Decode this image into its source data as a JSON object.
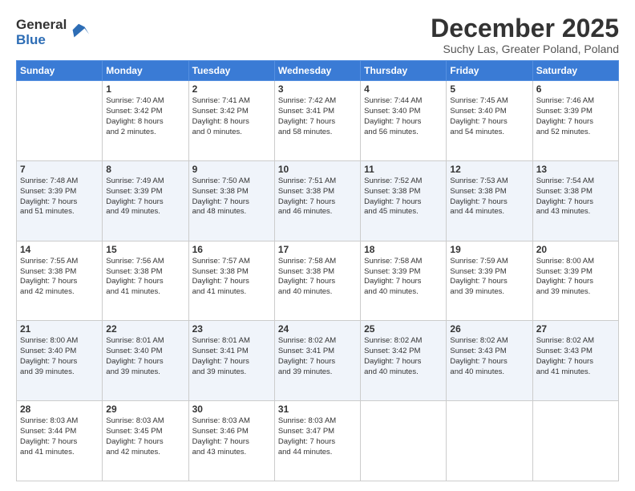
{
  "logo": {
    "general": "General",
    "blue": "Blue"
  },
  "title": "December 2025",
  "subtitle": "Suchy Las, Greater Poland, Poland",
  "days_of_week": [
    "Sunday",
    "Monday",
    "Tuesday",
    "Wednesday",
    "Thursday",
    "Friday",
    "Saturday"
  ],
  "weeks": [
    [
      {
        "day": "",
        "info": ""
      },
      {
        "day": "1",
        "info": "Sunrise: 7:40 AM\nSunset: 3:42 PM\nDaylight: 8 hours\nand 2 minutes."
      },
      {
        "day": "2",
        "info": "Sunrise: 7:41 AM\nSunset: 3:42 PM\nDaylight: 8 hours\nand 0 minutes."
      },
      {
        "day": "3",
        "info": "Sunrise: 7:42 AM\nSunset: 3:41 PM\nDaylight: 7 hours\nand 58 minutes."
      },
      {
        "day": "4",
        "info": "Sunrise: 7:44 AM\nSunset: 3:40 PM\nDaylight: 7 hours\nand 56 minutes."
      },
      {
        "day": "5",
        "info": "Sunrise: 7:45 AM\nSunset: 3:40 PM\nDaylight: 7 hours\nand 54 minutes."
      },
      {
        "day": "6",
        "info": "Sunrise: 7:46 AM\nSunset: 3:39 PM\nDaylight: 7 hours\nand 52 minutes."
      }
    ],
    [
      {
        "day": "7",
        "info": "Sunrise: 7:48 AM\nSunset: 3:39 PM\nDaylight: 7 hours\nand 51 minutes."
      },
      {
        "day": "8",
        "info": "Sunrise: 7:49 AM\nSunset: 3:39 PM\nDaylight: 7 hours\nand 49 minutes."
      },
      {
        "day": "9",
        "info": "Sunrise: 7:50 AM\nSunset: 3:38 PM\nDaylight: 7 hours\nand 48 minutes."
      },
      {
        "day": "10",
        "info": "Sunrise: 7:51 AM\nSunset: 3:38 PM\nDaylight: 7 hours\nand 46 minutes."
      },
      {
        "day": "11",
        "info": "Sunrise: 7:52 AM\nSunset: 3:38 PM\nDaylight: 7 hours\nand 45 minutes."
      },
      {
        "day": "12",
        "info": "Sunrise: 7:53 AM\nSunset: 3:38 PM\nDaylight: 7 hours\nand 44 minutes."
      },
      {
        "day": "13",
        "info": "Sunrise: 7:54 AM\nSunset: 3:38 PM\nDaylight: 7 hours\nand 43 minutes."
      }
    ],
    [
      {
        "day": "14",
        "info": "Sunrise: 7:55 AM\nSunset: 3:38 PM\nDaylight: 7 hours\nand 42 minutes."
      },
      {
        "day": "15",
        "info": "Sunrise: 7:56 AM\nSunset: 3:38 PM\nDaylight: 7 hours\nand 41 minutes."
      },
      {
        "day": "16",
        "info": "Sunrise: 7:57 AM\nSunset: 3:38 PM\nDaylight: 7 hours\nand 41 minutes."
      },
      {
        "day": "17",
        "info": "Sunrise: 7:58 AM\nSunset: 3:38 PM\nDaylight: 7 hours\nand 40 minutes."
      },
      {
        "day": "18",
        "info": "Sunrise: 7:58 AM\nSunset: 3:39 PM\nDaylight: 7 hours\nand 40 minutes."
      },
      {
        "day": "19",
        "info": "Sunrise: 7:59 AM\nSunset: 3:39 PM\nDaylight: 7 hours\nand 39 minutes."
      },
      {
        "day": "20",
        "info": "Sunrise: 8:00 AM\nSunset: 3:39 PM\nDaylight: 7 hours\nand 39 minutes."
      }
    ],
    [
      {
        "day": "21",
        "info": "Sunrise: 8:00 AM\nSunset: 3:40 PM\nDaylight: 7 hours\nand 39 minutes."
      },
      {
        "day": "22",
        "info": "Sunrise: 8:01 AM\nSunset: 3:40 PM\nDaylight: 7 hours\nand 39 minutes."
      },
      {
        "day": "23",
        "info": "Sunrise: 8:01 AM\nSunset: 3:41 PM\nDaylight: 7 hours\nand 39 minutes."
      },
      {
        "day": "24",
        "info": "Sunrise: 8:02 AM\nSunset: 3:41 PM\nDaylight: 7 hours\nand 39 minutes."
      },
      {
        "day": "25",
        "info": "Sunrise: 8:02 AM\nSunset: 3:42 PM\nDaylight: 7 hours\nand 40 minutes."
      },
      {
        "day": "26",
        "info": "Sunrise: 8:02 AM\nSunset: 3:43 PM\nDaylight: 7 hours\nand 40 minutes."
      },
      {
        "day": "27",
        "info": "Sunrise: 8:02 AM\nSunset: 3:43 PM\nDaylight: 7 hours\nand 41 minutes."
      }
    ],
    [
      {
        "day": "28",
        "info": "Sunrise: 8:03 AM\nSunset: 3:44 PM\nDaylight: 7 hours\nand 41 minutes."
      },
      {
        "day": "29",
        "info": "Sunrise: 8:03 AM\nSunset: 3:45 PM\nDaylight: 7 hours\nand 42 minutes."
      },
      {
        "day": "30",
        "info": "Sunrise: 8:03 AM\nSunset: 3:46 PM\nDaylight: 7 hours\nand 43 minutes."
      },
      {
        "day": "31",
        "info": "Sunrise: 8:03 AM\nSunset: 3:47 PM\nDaylight: 7 hours\nand 44 minutes."
      },
      {
        "day": "",
        "info": ""
      },
      {
        "day": "",
        "info": ""
      },
      {
        "day": "",
        "info": ""
      }
    ]
  ]
}
